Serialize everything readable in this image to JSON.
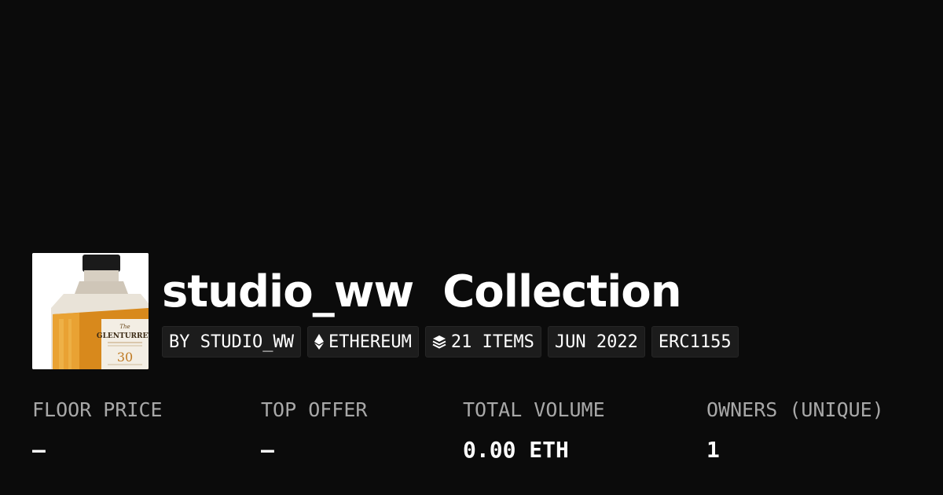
{
  "collection": {
    "name": "studio_ww",
    "title_suffix": "Collection",
    "image": {
      "bottle_label_small": "The",
      "bottle_label_brand": "GLENTURRET",
      "bottle_label_age": "30"
    }
  },
  "tags": [
    {
      "label": "BY STUDIO_WW",
      "icon": null
    },
    {
      "label": "ETHEREUM",
      "icon": "ethereum-icon"
    },
    {
      "label": "21 ITEMS",
      "icon": "layers-icon"
    },
    {
      "label": "JUN 2022",
      "icon": null
    },
    {
      "label": "ERC1155",
      "icon": null
    }
  ],
  "stats": [
    {
      "label": "FLOOR PRICE",
      "value": "–"
    },
    {
      "label": "TOP OFFER",
      "value": "–"
    },
    {
      "label": "TOTAL VOLUME",
      "value": "0.00 ETH"
    },
    {
      "label": "OWNERS (UNIQUE)",
      "value": "1"
    }
  ],
  "colors": {
    "background": "#0b0b0b",
    "text": "#ffffff",
    "muted_label": "#a8a8a8",
    "tag_background": "#1c1c1c"
  }
}
